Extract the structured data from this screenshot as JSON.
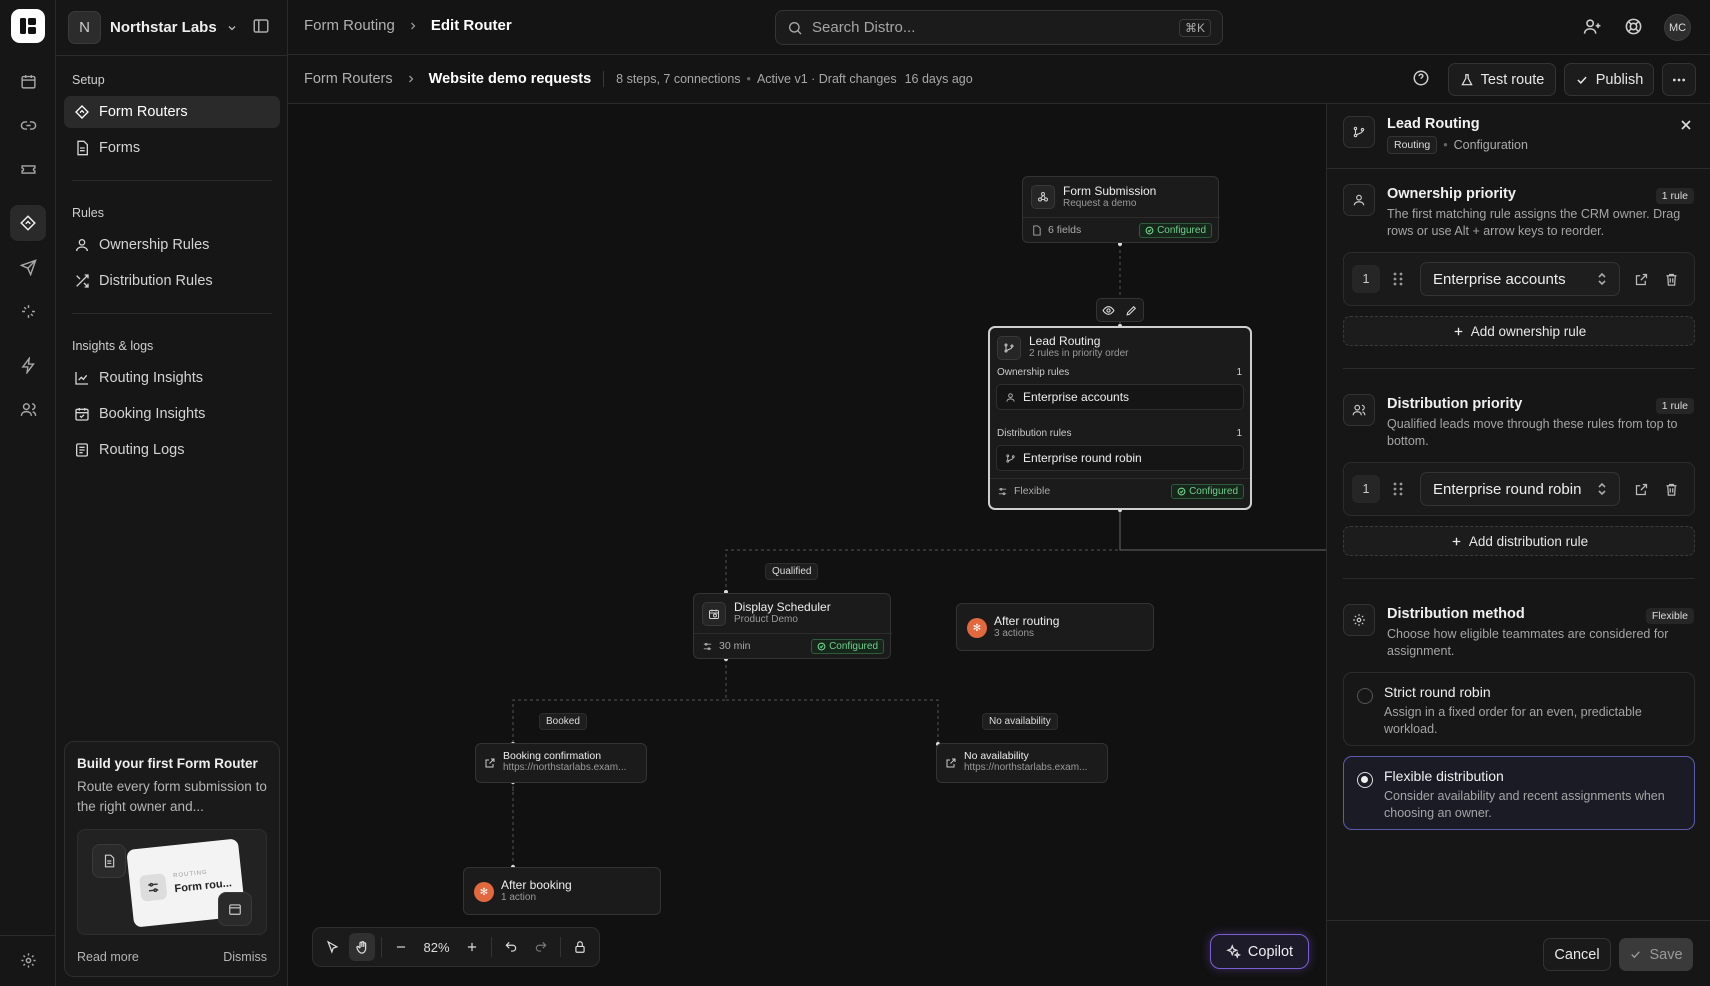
{
  "workspace": {
    "initial": "N",
    "name": "Northstar Labs"
  },
  "breadcrumb": {
    "parent": "Form Routing",
    "current": "Edit Router"
  },
  "search": {
    "placeholder": "Search Distro...",
    "shortcut": "⌘K"
  },
  "user": {
    "initials": "MC"
  },
  "sidebar": {
    "setup_heading": "Setup",
    "setup_items": [
      {
        "label": "Form Routers"
      },
      {
        "label": "Forms"
      }
    ],
    "rules_heading": "Rules",
    "rules_items": [
      {
        "label": "Ownership Rules"
      },
      {
        "label": "Distribution Rules"
      }
    ],
    "insights_heading": "Insights & logs",
    "insights_items": [
      {
        "label": "Routing Insights"
      },
      {
        "label": "Booking Insights"
      },
      {
        "label": "Routing Logs"
      }
    ]
  },
  "promo": {
    "title": "Build your first Form Router",
    "text": "Route every form submission to the right owner and...",
    "card_caption": "ROUTING",
    "card_label": "Form rou...",
    "read_more": "Read more",
    "dismiss": "Dismiss"
  },
  "subbar": {
    "parent": "Form Routers",
    "current": "Website demo requests",
    "stats": "8 steps, 7 connections",
    "status": "Active v1 · Draft changes",
    "updated": "16 days ago",
    "test_route": "Test route",
    "publish": "Publish"
  },
  "canvas": {
    "form_node": {
      "title": "Form Submission",
      "subtitle": "Request a demo",
      "meta": "6 fields",
      "status": "Configured"
    },
    "lead_node": {
      "title": "Lead Routing",
      "subtitle": "2 rules in priority order",
      "ownership_label": "Ownership rules",
      "ownership_count": "1",
      "ownership_rule": "Enterprise accounts",
      "distribution_label": "Distribution rules",
      "distribution_count": "1",
      "distribution_rule": "Enterprise round robin",
      "mode": "Flexible",
      "status": "Configured"
    },
    "scheduler_node": {
      "title": "Display Scheduler",
      "subtitle": "Product Demo",
      "meta": "30 min",
      "status": "Configured"
    },
    "after_routing": {
      "title": "After routing",
      "subtitle": "3 actions"
    },
    "booking_confirmation": {
      "title": "Booking confirmation",
      "url": "https://northstarlabs.exam..."
    },
    "no_availability_node": {
      "title": "No availability",
      "url": "https://northstarlabs.exam..."
    },
    "after_booking": {
      "title": "After booking",
      "subtitle": "1 action"
    },
    "edge_labels": {
      "qualified": "Qualified",
      "booked": "Booked",
      "no_availability": "No availability"
    },
    "zoom": "82%",
    "copilot": "Copilot"
  },
  "panel": {
    "title": "Lead Routing",
    "tag": "Routing",
    "section": "Configuration",
    "ownership": {
      "title": "Ownership priority",
      "badge": "1 rule",
      "desc": "The first matching rule assigns the CRM owner. Drag rows or use Alt + arrow keys to reorder.",
      "rank": "1",
      "rule": "Enterprise accounts",
      "add": "Add ownership rule"
    },
    "distribution": {
      "title": "Distribution priority",
      "badge": "1 rule",
      "desc": "Qualified leads move through these rules from top to bottom.",
      "rank": "1",
      "rule": "Enterprise round robin",
      "add": "Add distribution rule"
    },
    "method": {
      "title": "Distribution method",
      "badge": "Flexible",
      "desc": "Choose how eligible teammates are considered for assignment.",
      "options": [
        {
          "title": "Strict round robin",
          "desc": "Assign in a fixed order for an even, predictable workload.",
          "selected": false
        },
        {
          "title": "Flexible distribution",
          "desc": "Consider availability and recent assignments when choosing an owner.",
          "selected": true
        }
      ]
    },
    "cancel": "Cancel",
    "save": "Save"
  },
  "colors": {
    "accent": "#5b5cae",
    "configured": "#6fcf8a",
    "orange": "#e2683e"
  }
}
